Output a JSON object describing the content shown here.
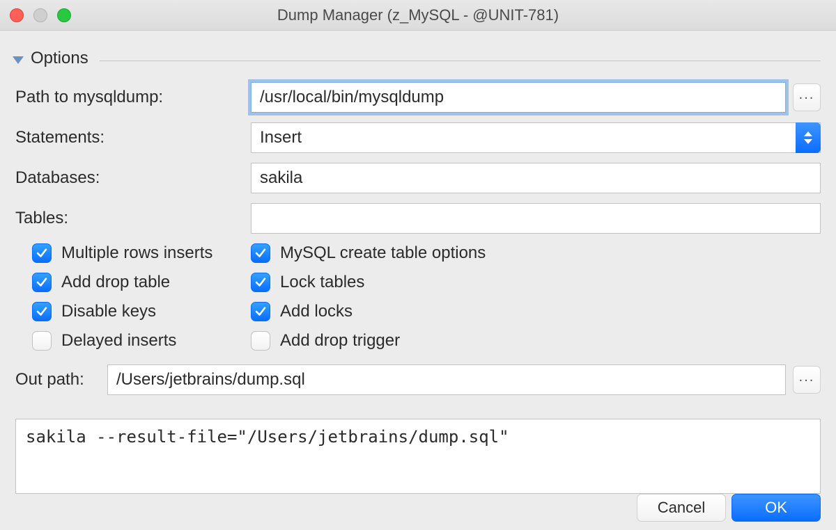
{
  "window": {
    "title": "Dump Manager (z_MySQL - @UNIT-781)"
  },
  "section": {
    "title": "Options"
  },
  "fields": {
    "path_label": "Path to mysqldump:",
    "path_value": "/usr/local/bin/mysqldump",
    "statements_label": "Statements:",
    "statements_value": "Insert",
    "databases_label": "Databases:",
    "databases_value": "sakila",
    "tables_label": "Tables:",
    "tables_value": "",
    "out_path_label": "Out path:",
    "out_path_value": "/Users/jetbrains/dump.sql"
  },
  "checks": {
    "left": [
      {
        "label": "Multiple rows inserts",
        "checked": true
      },
      {
        "label": "Add drop table",
        "checked": true
      },
      {
        "label": "Disable keys",
        "checked": true
      },
      {
        "label": "Delayed inserts",
        "checked": false
      }
    ],
    "right": [
      {
        "label": "MySQL create table options",
        "checked": true
      },
      {
        "label": "Lock tables",
        "checked": true
      },
      {
        "label": "Add locks",
        "checked": true
      },
      {
        "label": "Add drop trigger",
        "checked": false
      }
    ]
  },
  "command_preview": "sakila --result-file=\"/Users/jetbrains/dump.sql\"",
  "footer": {
    "cancel": "Cancel",
    "ok": "OK"
  },
  "browse": "..."
}
